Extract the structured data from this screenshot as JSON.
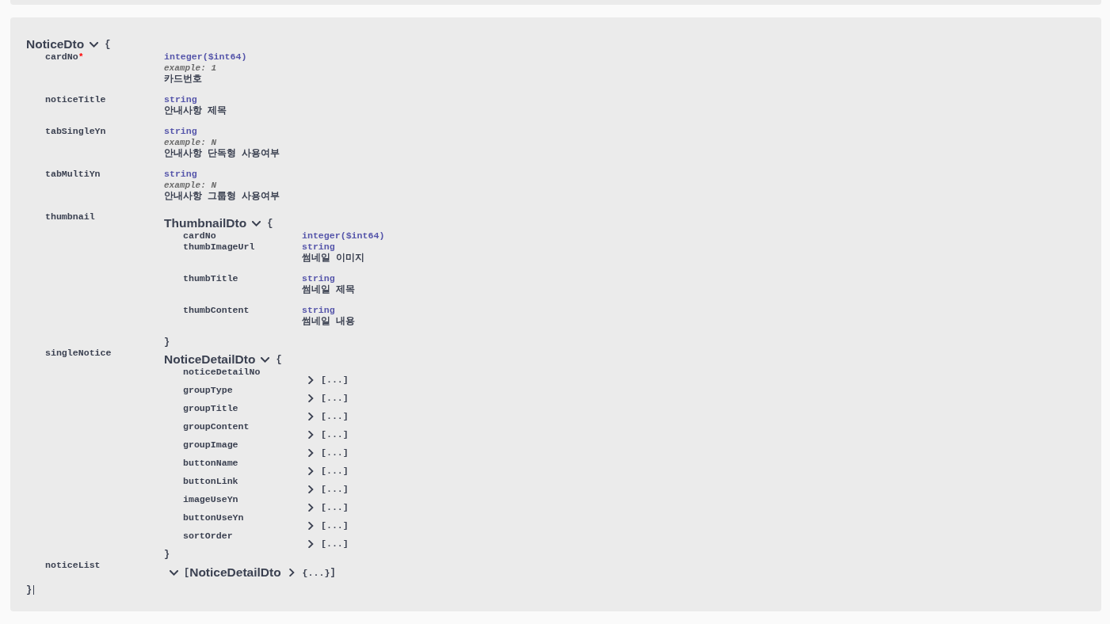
{
  "model": {
    "name": "NoticeDto",
    "expanded": true,
    "open_brace": "{",
    "close_brace": "}",
    "properties": [
      {
        "kind": "primitive",
        "name": "cardNo",
        "required_mark": "*",
        "type": "integer($int64)",
        "example": "example: 1",
        "description": "카드번호"
      },
      {
        "kind": "primitive",
        "name": "noticeTitle",
        "type": "string",
        "description": "안내사항 제목"
      },
      {
        "kind": "primitive",
        "name": "tabSingleYn",
        "type": "string",
        "example": "example: N",
        "description": "안내사항 단독형 사용여부"
      },
      {
        "kind": "primitive",
        "name": "tabMultiYn",
        "type": "string",
        "example": "example: N",
        "description": "안내사항 그룹형 사용여부"
      },
      {
        "kind": "model",
        "name": "thumbnail",
        "model": {
          "name": "ThumbnailDto",
          "expanded": true,
          "open_brace": "{",
          "close_brace": "}",
          "properties": [
            {
              "kind": "primitive",
              "name": "cardNo",
              "type": "integer($int64)"
            },
            {
              "kind": "primitive",
              "name": "thumbImageUrl",
              "type": "string",
              "description": "썸네일 이미지"
            },
            {
              "kind": "primitive",
              "name": "thumbTitle",
              "type": "string",
              "description": "썸네일 제목"
            },
            {
              "kind": "primitive",
              "name": "thumbContent",
              "type": "string",
              "description": "썸네일 내용"
            }
          ]
        }
      },
      {
        "kind": "model",
        "name": "singleNotice",
        "model": {
          "name": "NoticeDetailDto",
          "expanded": true,
          "open_brace": "{",
          "close_brace": "}",
          "properties": [
            {
              "kind": "collapsed",
              "name": "noticeDetailNo",
              "expanded": false,
              "summary": "[...]"
            },
            {
              "kind": "collapsed",
              "name": "groupType",
              "expanded": false,
              "summary": "[...]"
            },
            {
              "kind": "collapsed",
              "name": "groupTitle",
              "expanded": false,
              "summary": "[...]"
            },
            {
              "kind": "collapsed",
              "name": "groupContent",
              "expanded": false,
              "summary": "[...]"
            },
            {
              "kind": "collapsed",
              "name": "groupImage",
              "expanded": false,
              "summary": "[...]"
            },
            {
              "kind": "collapsed",
              "name": "buttonName",
              "expanded": false,
              "summary": "[...]"
            },
            {
              "kind": "collapsed",
              "name": "buttonLink",
              "expanded": false,
              "summary": "[...]"
            },
            {
              "kind": "collapsed",
              "name": "imageUseYn",
              "expanded": false,
              "summary": "[...]"
            },
            {
              "kind": "collapsed",
              "name": "buttonUseYn",
              "expanded": false,
              "summary": "[...]"
            },
            {
              "kind": "collapsed",
              "name": "sortOrder",
              "expanded": false,
              "summary": "[...]"
            }
          ]
        }
      },
      {
        "kind": "array",
        "name": "noticeList",
        "expanded": true,
        "open_bracket": "[",
        "item": {
          "name": "NoticeDetailDto",
          "expanded": false,
          "summary": "{...}"
        },
        "close_bracket": "]"
      }
    ]
  }
}
